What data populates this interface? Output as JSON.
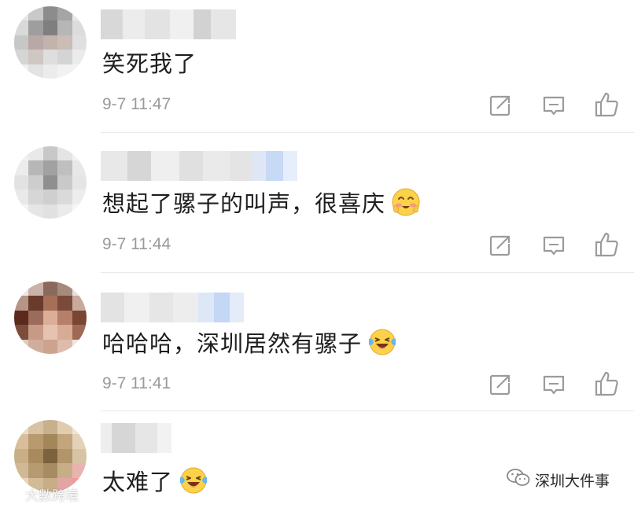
{
  "comments": [
    {
      "text": "笑死我了",
      "time": "9-7 11:47",
      "emoji": null
    },
    {
      "text": "想起了骡子的叫声，很喜庆",
      "time": "9-7 11:44",
      "emoji": "blushing-smile-emoji"
    },
    {
      "text": "哈哈哈，深圳居然有骡子",
      "time": "9-7 11:41",
      "emoji": "laughing-tears-emoji"
    },
    {
      "text": "太难了",
      "time": "",
      "emoji": "laughing-tears-emoji"
    }
  ],
  "actions": {
    "share_icon": "share-icon",
    "comment_icon": "comment-icon",
    "like_icon": "thumbs-up-icon"
  },
  "watermarks": {
    "left": "大數跨境",
    "right": "深圳大件事"
  },
  "colors": {
    "text": "#1e1e1e",
    "time": "#9a9a9a",
    "icon": "#9b9b9b",
    "divider": "#e9e9e9"
  }
}
